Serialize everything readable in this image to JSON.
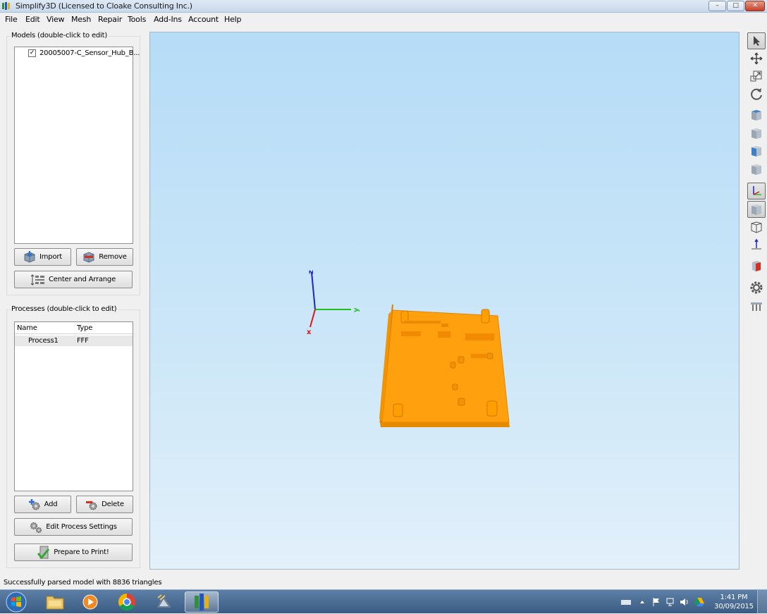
{
  "window": {
    "title": "Simplify3D (Licensed to Cloake Consulting Inc.)",
    "minimize_symbol": "–",
    "maximize_symbol": "□",
    "close_symbol": "✕"
  },
  "menu": [
    "File",
    "Edit",
    "View",
    "Mesh",
    "Repair",
    "Tools",
    "Add-Ins",
    "Account",
    "Help"
  ],
  "models_panel": {
    "label": "Models (double-click to edit)",
    "items": [
      {
        "name": "20005007-C_Sensor_Hub_B...",
        "checked": true
      }
    ],
    "import_label": "Import",
    "remove_label": "Remove",
    "center_arrange_label": "Center and Arrange"
  },
  "processes_panel": {
    "label": "Processes (double-click to edit)",
    "col_name": "Name",
    "col_type": "Type",
    "rows": [
      {
        "name": "Process1",
        "type": "FFF"
      }
    ],
    "add_label": "Add",
    "delete_label": "Delete",
    "edit_label": "Edit Process Settings",
    "prepare_label": "Prepare to Print!"
  },
  "viewport": {
    "axis_labels": {
      "x": "x",
      "y": "y",
      "z": "z"
    },
    "model_color": "#ffa00f",
    "background_top": "#b6dcf7",
    "background_bottom": "#e2f0fa"
  },
  "toolbar": [
    "select-icon",
    "move-icon",
    "scale-icon",
    "rotate-icon",
    "view-top-icon",
    "view-front-icon",
    "view-left-icon",
    "view-iso-icon",
    "axes-toggle-icon",
    "solid-view-icon",
    "wireframe-view-icon",
    "ground-axis-icon",
    "cross-section-icon",
    "settings-icon",
    "build-table-icon"
  ],
  "status": {
    "message": "Successfully parsed model with 8836 triangles"
  },
  "taskbar": {
    "apps": [
      "start-orb-icon",
      "explorer-icon",
      "media-player-icon",
      "chrome-icon",
      "satellite-icon",
      "simplify3d-icon"
    ],
    "time": "1:41 PM",
    "date": "30/09/2015"
  }
}
